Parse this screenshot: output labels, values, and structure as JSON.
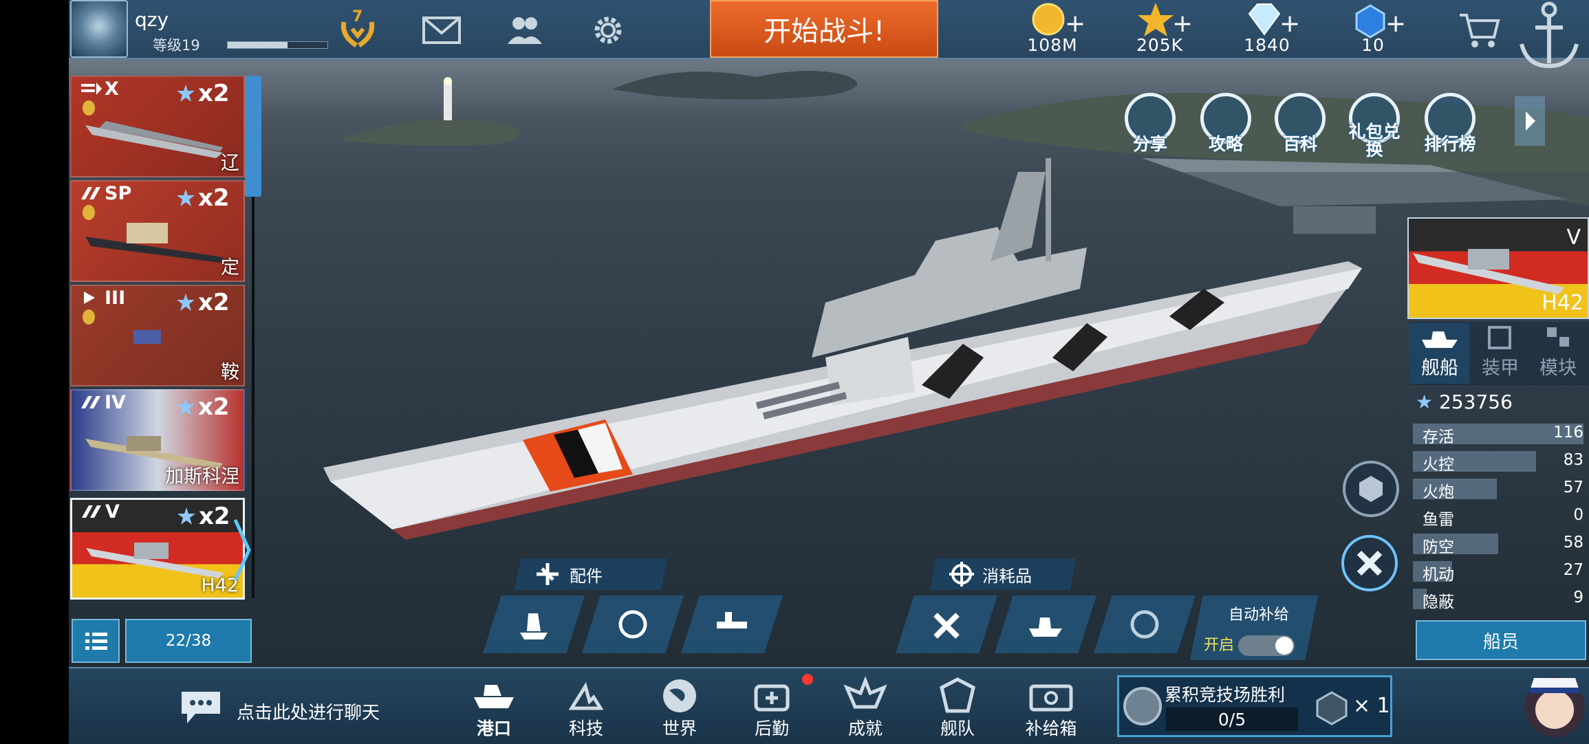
{
  "player": {
    "name": "qzy",
    "level_label": "等级19",
    "xp_progress": 0.6,
    "rank_number": "7"
  },
  "top": {
    "battle_button": "开始战斗!",
    "currencies": [
      {
        "icon": "gold-coin-icon",
        "value": "108M"
      },
      {
        "icon": "star-points-icon",
        "value": "205K"
      },
      {
        "icon": "diamond-icon",
        "value": "1840"
      },
      {
        "icon": "blue-gem-icon",
        "value": "10"
      }
    ],
    "plus": "+"
  },
  "ship_list": [
    {
      "tier": "X",
      "multiplier": "x2",
      "name": "辽"
    },
    {
      "tier": "SP",
      "multiplier": "x2",
      "name": "定"
    },
    {
      "tier": "III",
      "multiplier": "x2",
      "name": "鞍"
    },
    {
      "tier": "IV",
      "multiplier": "x2",
      "name": "加斯科涅"
    },
    {
      "tier": "V",
      "multiplier": "x2",
      "name": "H42"
    }
  ],
  "list_count": "22/38",
  "quick_menu": [
    {
      "label": "分享",
      "icon": "share-icon"
    },
    {
      "label": "攻略",
      "icon": "guide-home-icon"
    },
    {
      "label": "百科",
      "icon": "encyclopedia-icon"
    },
    {
      "label": "礼包兑换",
      "icon": "gift-redeem-icon"
    },
    {
      "label": "排行榜",
      "icon": "leaderboard-icon"
    }
  ],
  "selected_ship": {
    "tier": "V",
    "name": "H42",
    "tabs": [
      "舰船",
      "装甲",
      "模块"
    ],
    "power": "253756",
    "stats": [
      {
        "name": "存活",
        "value": "116",
        "fill": 1.0
      },
      {
        "name": "火控",
        "value": "83",
        "fill": 0.72
      },
      {
        "name": "火炮",
        "value": "57",
        "fill": 0.49
      },
      {
        "name": "鱼雷",
        "value": "0",
        "fill": 0.0
      },
      {
        "name": "防空",
        "value": "58",
        "fill": 0.5
      },
      {
        "name": "机动",
        "value": "27",
        "fill": 0.23
      },
      {
        "name": "隐蔽",
        "value": "9",
        "fill": 0.08
      }
    ],
    "crew_button": "船员"
  },
  "parts_label": "配件",
  "consumables_label": "消耗品",
  "auto_supply": {
    "label": "自动补给",
    "state": "开启",
    "on": true
  },
  "chat_prompt": "点击此处进行聊天",
  "nav": [
    {
      "label": "港口",
      "icon": "port-icon",
      "active": true
    },
    {
      "label": "科技",
      "icon": "tech-icon",
      "active": false
    },
    {
      "label": "世界",
      "icon": "globe-icon",
      "active": false
    },
    {
      "label": "后勤",
      "icon": "logistics-icon",
      "active": false
    },
    {
      "label": "成就",
      "icon": "achievement-icon",
      "active": false
    },
    {
      "label": "舰队",
      "icon": "fleet-icon",
      "active": false
    },
    {
      "label": "补给箱",
      "icon": "supply-box-icon",
      "active": false
    }
  ],
  "arena": {
    "title": "累积竞技场胜利",
    "progress": "0/5",
    "reward_count": "× 1"
  }
}
